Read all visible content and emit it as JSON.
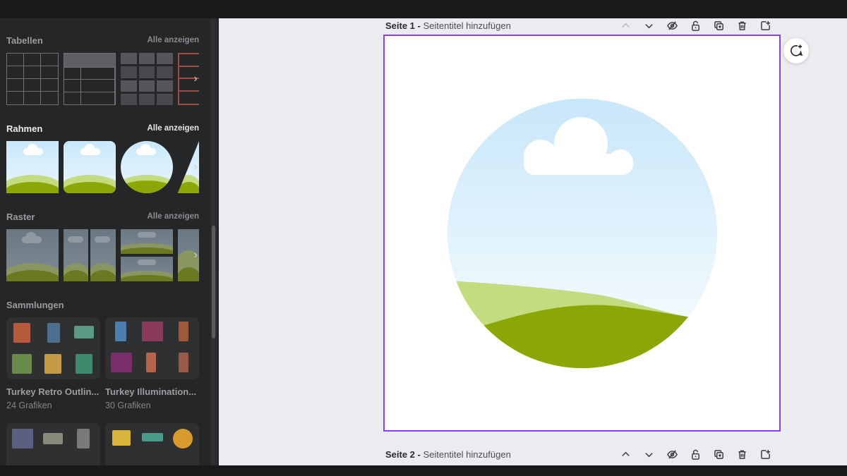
{
  "sidebar": {
    "sections": {
      "tables": {
        "title": "Tabellen",
        "see_all": "Alle anzeigen"
      },
      "frames": {
        "title": "Rahmen",
        "see_all": "Alle anzeigen"
      },
      "grids": {
        "title": "Raster",
        "see_all": "Alle anzeigen"
      },
      "collections": {
        "title": "Sammlungen"
      }
    },
    "collections": [
      {
        "name": "Turkey Retro Outlin...",
        "count": "24 Grafiken"
      },
      {
        "name": "Turkey Illumination...",
        "count": "30 Grafiken"
      }
    ],
    "scroll_arrow": "›",
    "collapse_icon": "‹"
  },
  "canvas": {
    "pages": [
      {
        "label": "Seite 1 -",
        "title_placeholder": "Seitentitel hinzufügen"
      },
      {
        "label": "Seite 2 -",
        "title_placeholder": "Seitentitel hinzufügen"
      }
    ],
    "tool_icons": [
      "chevron-up-icon",
      "chevron-down-icon",
      "eye-off-icon",
      "lock-open-icon",
      "duplicate-icon",
      "trash-icon",
      "add-page-icon"
    ]
  },
  "colors": {
    "selection_border": "#8b3dff",
    "sky": "#c8e7fa",
    "hill_light": "#c3dc7f",
    "hill_dark": "#8aa706"
  }
}
